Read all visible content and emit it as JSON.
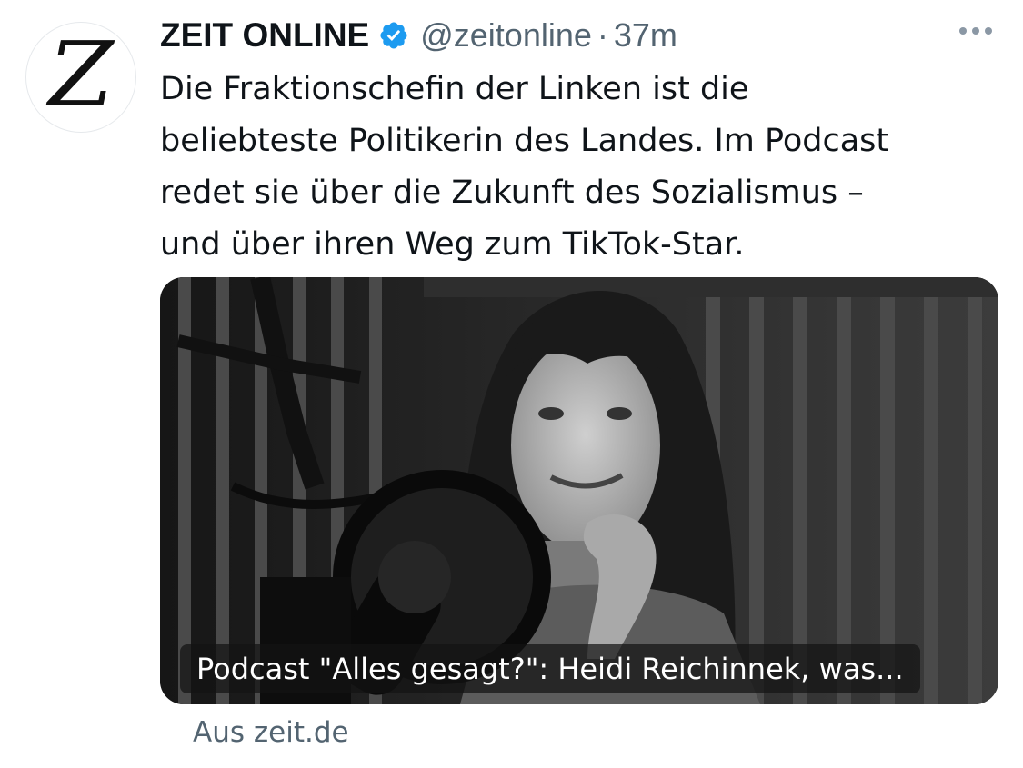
{
  "tweet": {
    "author_name": "ZEIT ONLINE",
    "handle": "@zeitonline",
    "separator": "·",
    "time": "37m",
    "avatar_letter": "Z",
    "text_lines": [
      "Die Fraktionschefin der Linken ist die",
      "beliebteste Politikerin des Landes. Im Podcast",
      "redet sie über die Zukunft des Sozialismus –",
      "und über ihren Weg zum TikTok-Star."
    ]
  },
  "card": {
    "caption": "Podcast \"Alles gesagt?\": Heidi Reichinnek, was...",
    "source": "Aus zeit.de"
  },
  "icons": {
    "verified": "verified-badge-icon",
    "more": "more-options-icon"
  },
  "colors": {
    "verified_blue": "#1d9bf0",
    "secondary_text": "#536471"
  }
}
